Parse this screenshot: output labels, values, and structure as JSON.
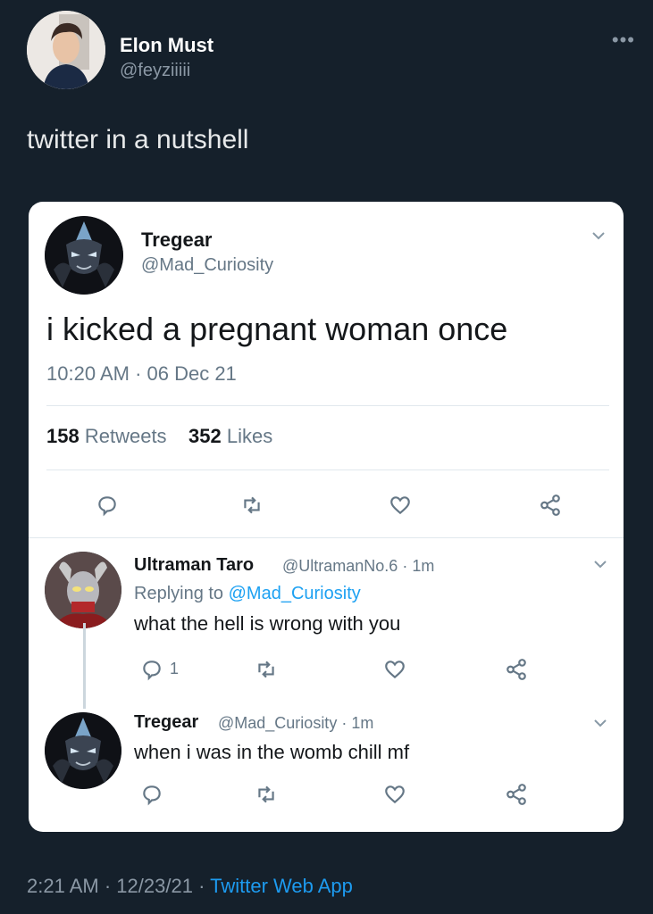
{
  "outer_tweet": {
    "display_name": "Elon Must",
    "handle": "@feyziiiii",
    "more_icon": "more-icon",
    "text": "twitter in a nutshell",
    "time": "2:21 AM",
    "date": "12/23/21",
    "source": "Twitter Web App",
    "separator": "·"
  },
  "embedded": {
    "main": {
      "display_name": "Tregear",
      "handle": "@Mad_Curiosity",
      "text": "i kicked a pregnant woman once",
      "timestamp": "10:20 AM · 06 Dec 21",
      "retweets_count": "158",
      "retweets_label": "Retweets",
      "likes_count": "352",
      "likes_label": "Likes"
    },
    "reply1": {
      "display_name": "Ultraman Taro",
      "handle": "@UltramanNo.6",
      "age": "· 1m",
      "replying_prefix": "Replying to",
      "replying_to": "@Mad_Curiosity",
      "text": "what the hell is wrong with you",
      "reply_count": "1"
    },
    "reply2": {
      "display_name": "Tregear",
      "handle": "@Mad_Curiosity",
      "age": "· 1m",
      "text": "when i was in the womb chill mf"
    }
  },
  "colors": {
    "background": "#15202b",
    "card": "#ffffff",
    "link": "#1da1f2",
    "muted": "#657786"
  }
}
